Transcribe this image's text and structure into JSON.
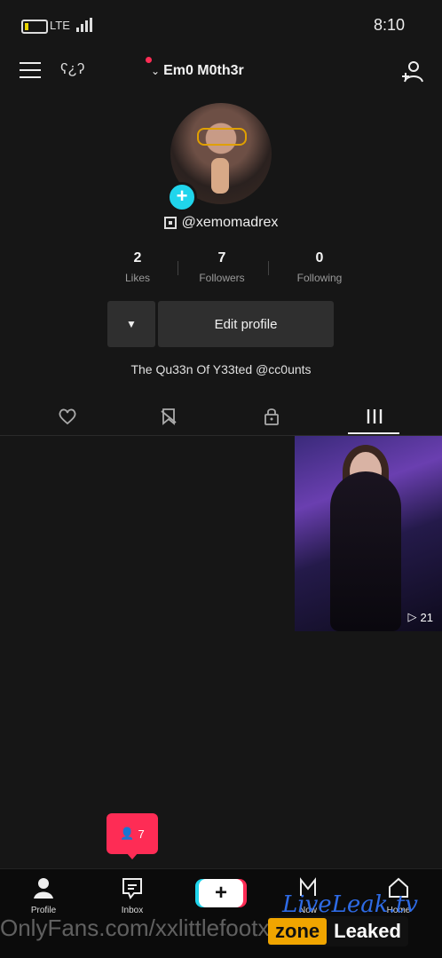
{
  "status_bar": {
    "network": "LTE",
    "time": "8:10"
  },
  "header": {
    "username": "Em0 M0th3r",
    "left_icon_text": "ʕ¿ʔ"
  },
  "profile": {
    "handle": "@xemomadrex",
    "stats": [
      {
        "value": "2",
        "label": "Likes"
      },
      {
        "value": "7",
        "label": "Followers"
      },
      {
        "value": "0",
        "label": "Following"
      }
    ],
    "edit_label": "Edit profile",
    "bio": "The Qu33n Of Y33ted @cc0unts"
  },
  "video": {
    "views": "21"
  },
  "badge": {
    "count": "7"
  },
  "nav": {
    "profile": "Profile",
    "inbox": "Inbox",
    "now": "Now",
    "home": "Home"
  },
  "watermark": {
    "url": "OnlyFans.com/xxlittlefootx",
    "brand_a": "Leaked",
    "brand_b": "zone",
    "script": "LiveLeak.tv"
  },
  "colors": {
    "accent_red": "#fe2c55",
    "accent_cyan": "#20d5ec"
  }
}
